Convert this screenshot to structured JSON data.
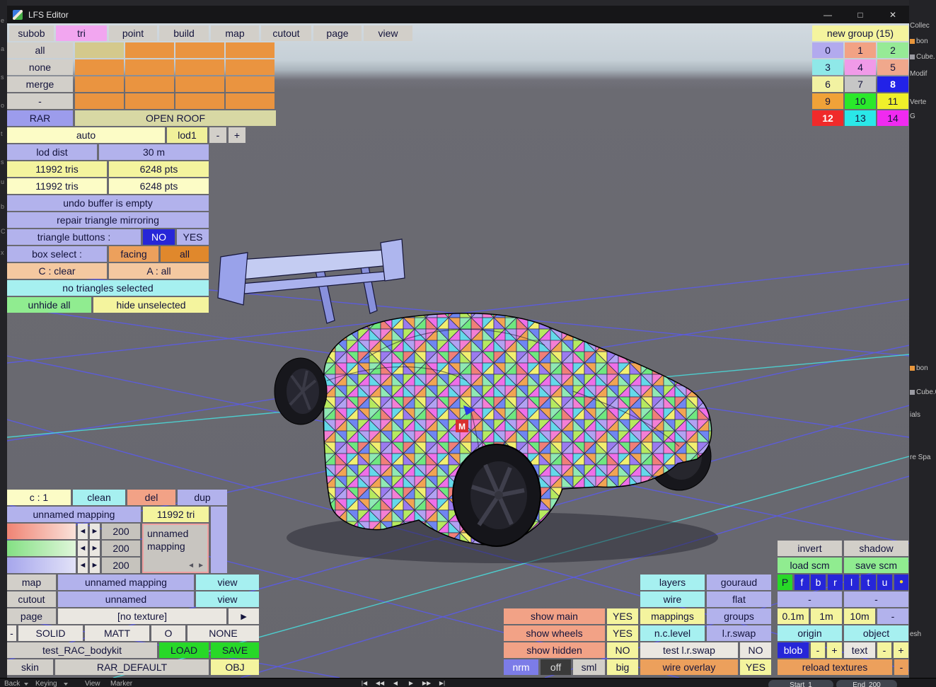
{
  "window": {
    "title": "LFS Editor",
    "minimize": "—",
    "maximize": "□",
    "close": "✕"
  },
  "tabs": [
    "subob",
    "tri",
    "point",
    "build",
    "map",
    "cutout",
    "page",
    "view"
  ],
  "left_panel": {
    "all": "all",
    "none": "none",
    "merge": "merge",
    "minus": "-",
    "rar": "RAR",
    "open_roof": "OPEN ROOF",
    "auto": "auto",
    "lod1": "lod1",
    "lod_minus": "-",
    "lod_plus": "+",
    "lod_dist_label": "lod dist",
    "lod_dist_value": "30 m",
    "tris_a": "11992 tris",
    "pts_a": "6248 pts",
    "tris_b": "11992 tris",
    "pts_b": "6248 pts",
    "undo_status": "undo buffer is empty",
    "repair": "repair triangle mirroring",
    "triangle_buttons_label": "triangle buttons :",
    "no": "NO",
    "yes": "YES",
    "box_select_label": "box select :",
    "facing": "facing",
    "all_mode": "all",
    "c_clear": "C : clear",
    "a_all": "A : all",
    "selection_status": "no triangles selected",
    "unhide_all": "unhide all",
    "hide_unselected": "hide unselected"
  },
  "groups": {
    "header": "new group (15)",
    "cells": [
      "0",
      "1",
      "2",
      "3",
      "4",
      "5",
      "6",
      "7",
      "8",
      "9",
      "10",
      "11",
      "12",
      "13",
      "14"
    ]
  },
  "mapping_panel": {
    "c1": "c : 1",
    "clean": "clean",
    "del": "del",
    "dup": "dup",
    "name": "unnamed mapping",
    "tri_count": "11992 tri",
    "values": [
      "200",
      "200",
      "200"
    ],
    "arrow_left": "◄",
    "arrow_right": "►",
    "box_name_line1": "unnamed",
    "box_name_line2": "mapping"
  },
  "texture_panel": {
    "map_label": "map",
    "map_value": "unnamed mapping",
    "map_view": "view",
    "cutout_label": "cutout",
    "cutout_value": "unnamed",
    "cutout_view": "view",
    "page_label": "page",
    "page_value": "[no texture]",
    "page_next": "►",
    "dash": "-",
    "solid": "SOLID",
    "matt": "MATT",
    "o": "O",
    "none": "NONE",
    "file_name": "test_RAC_bodykit",
    "load": "LOAD",
    "save": "SAVE",
    "skin_label": "skin",
    "skin_value": "RAR_DEFAULT",
    "obj": "OBJ"
  },
  "right_panel": {
    "invert": "invert",
    "shadow": "shadow",
    "load_scm": "load scm",
    "save_scm": "save scm",
    "proj": [
      "P",
      "f",
      "b",
      "r",
      "l",
      "t",
      "u",
      "●"
    ],
    "dash_left": "-",
    "dash_right": "-",
    "layers": "layers",
    "gouraud": "gouraud",
    "wire": "wire",
    "flat": "flat",
    "mappings": "mappings",
    "groups": "groups",
    "scale_01": "0.1m",
    "scale_1": "1m",
    "scale_10": "10m",
    "scale_dash": "-",
    "show_main": "show main",
    "show_main_val": "YES",
    "show_wheels": "show wheels",
    "show_wheels_val": "YES",
    "nc_level": "n.c.level",
    "lr_swap": "l.r.swap",
    "origin": "origin",
    "object": "object",
    "show_hidden": "show hidden",
    "show_hidden_val": "NO",
    "test_lr_swap": "test l.r.swap",
    "test_lr_val": "NO",
    "blob": "blob",
    "blob_minus": "-",
    "blob_plus": "+",
    "text": "text",
    "text_minus": "-",
    "text_plus": "+",
    "nrm": "nrm",
    "off": "off",
    "sml": "sml",
    "big": "big",
    "wire_overlay": "wire overlay",
    "wire_overlay_val": "YES",
    "reload_textures": "reload textures",
    "reload_dash": "-"
  },
  "viewport": {
    "marker": "M",
    "palette": [
      "#f47fd4",
      "#ef6fe8",
      "#9b7bf0",
      "#6f86f2",
      "#64d9ea",
      "#6fe87f",
      "#b6ea5f",
      "#f2a452",
      "#f07f78",
      "#b2a2f2",
      "#8fe9b4",
      "#f2ef6f"
    ],
    "grid_blue": "#5a5aec",
    "grid_cyan": "#4ad8d8"
  },
  "blender": {
    "right_items": [
      "Collec",
      "bon",
      "Cube.",
      "Modif",
      "Verte",
      "G",
      "bon",
      "Cube.0",
      "ials",
      "re Spa",
      "esh"
    ],
    "left_chars": [
      "e",
      "a",
      "s",
      "o",
      "t",
      "s",
      "u",
      "b",
      "C",
      "x"
    ],
    "timeline": {
      "back": "Back",
      "keying": "Keying",
      "view": "View",
      "marker": "Marker",
      "play_icons": [
        "|◀",
        "◀◀",
        "◀",
        "▶",
        "▶▶",
        "▶|"
      ],
      "start_label": "Start",
      "start_value": "1",
      "end_label": "End",
      "end_value": "200"
    }
  }
}
